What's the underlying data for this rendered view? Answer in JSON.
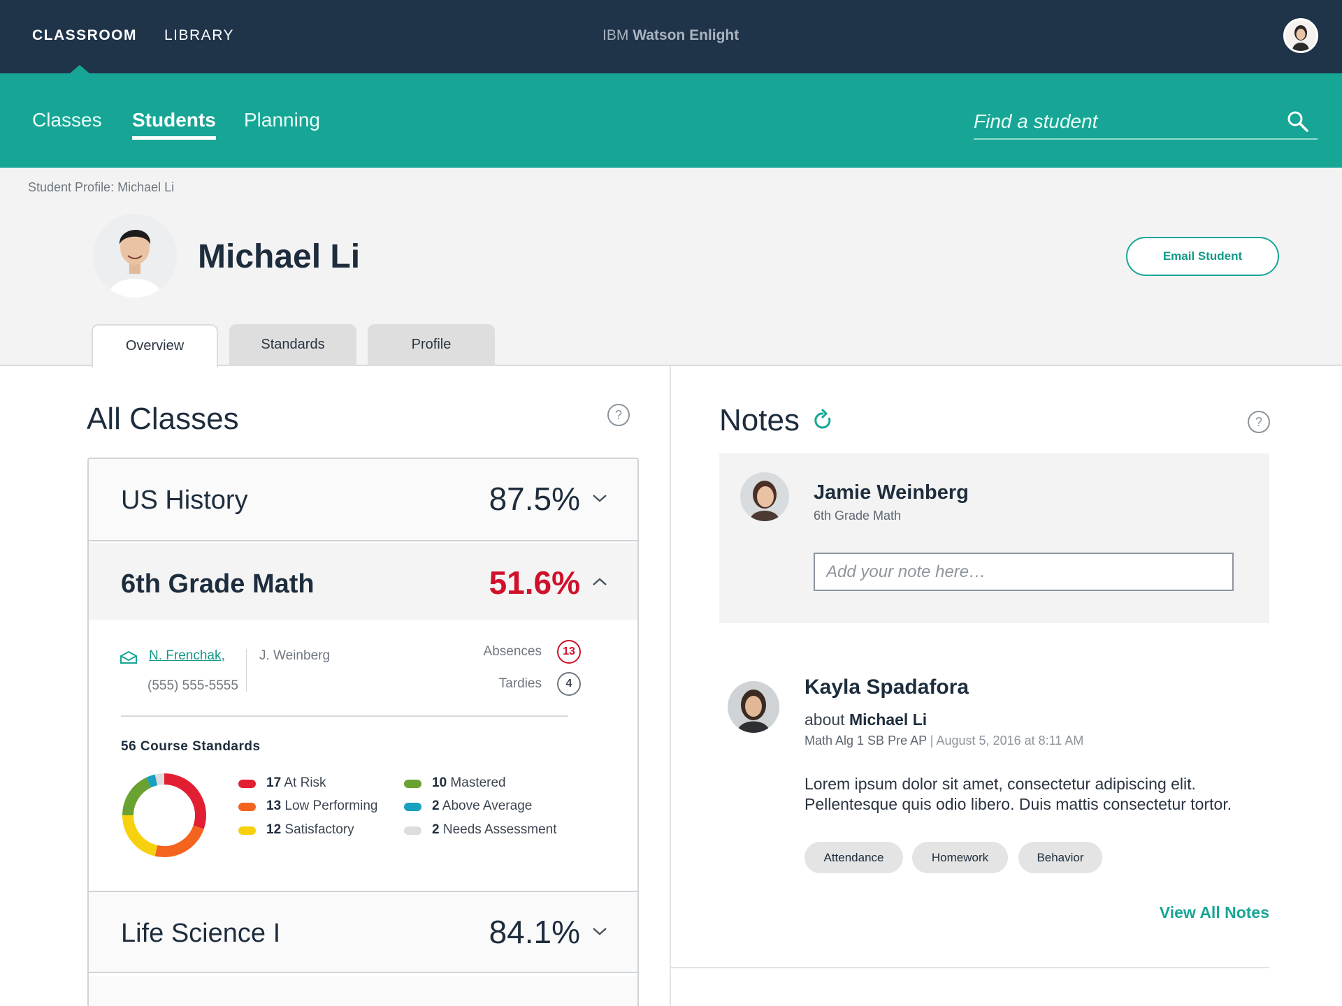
{
  "topbar": {
    "nav": [
      "CLASSROOM",
      "LIBRARY"
    ],
    "brand_prefix": "IBM",
    "brand_name": "Watson Enlight"
  },
  "subnav": {
    "items": [
      "Classes",
      "Students",
      "Planning"
    ],
    "active": "Students",
    "search_placeholder": "Find a student"
  },
  "profile": {
    "breadcrumb": "Student Profile: Michael Li",
    "student_name": "Michael Li",
    "email_button": "Email Student",
    "tabs": [
      "Overview",
      "Standards",
      "Profile"
    ],
    "active_tab": "Overview"
  },
  "classes": {
    "title": "All Classes",
    "help": "?",
    "rows": [
      {
        "name": "US History",
        "score": "87.5%",
        "expanded": false
      },
      {
        "name": "6th Grade Math",
        "score": "51.6%",
        "expanded": true,
        "score_color": "#d0112b"
      },
      {
        "name": "Life Science I",
        "score": "84.1%",
        "expanded": false
      }
    ],
    "detail": {
      "teacher": "N. Frenchak,",
      "phone": "(555) 555-5555",
      "co_teacher": "J. Weinberg",
      "absences_label": "Absences",
      "absences": "13",
      "tardies_label": "Tardies",
      "tardies": "4",
      "standards_title": "56 Course Standards",
      "legend": [
        {
          "count": "17",
          "label": "At Risk",
          "color": "#e21f32"
        },
        {
          "count": "13",
          "label": "Low Performing",
          "color": "#f4641f"
        },
        {
          "count": "12",
          "label": "Satisfactory",
          "color": "#f7d10d"
        },
        {
          "count": "10",
          "label": "Mastered",
          "color": "#6aa231"
        },
        {
          "count": "2",
          "label": "Above Average",
          "color": "#1aa1c0"
        },
        {
          "count": "2",
          "label": "Needs Assessment",
          "color": "#dddddd"
        }
      ]
    }
  },
  "notes": {
    "title": "Notes",
    "help": "?",
    "compose": {
      "author": "Jamie Weinberg",
      "subtitle": "6th Grade Math",
      "placeholder": "Add your note here…"
    },
    "note": {
      "author": "Kayla Spadafora",
      "about_prefix": "about",
      "about_name": "Michael Li",
      "class": "Math Alg 1 SB Pre AP",
      "separator": "|",
      "date": "August 5, 2016 at 8:11 AM",
      "body": "Lorem ipsum dolor sit amet, consectetur adipiscing elit. Pellentesque quis odio libero. Duis mattis consectetur tortor.",
      "tags": [
        "Attendance",
        "Homework",
        "Behavior"
      ]
    },
    "view_all": "View All Notes"
  },
  "colors": {
    "navy": "#1f3349",
    "teal": "#17a695",
    "alert_red": "#d0112b"
  }
}
